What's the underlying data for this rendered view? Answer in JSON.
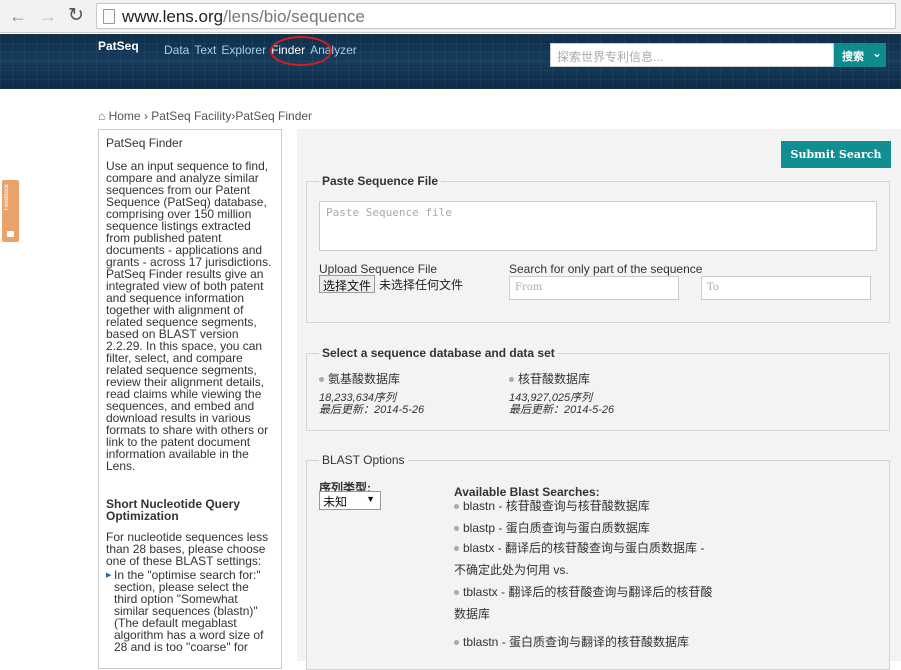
{
  "browser": {
    "url_host": "www.lens.org",
    "url_path": "/lens/bio/sequence"
  },
  "header": {
    "brand": "PatSeq",
    "nav": [
      "Data",
      "Text",
      "Explorer",
      "Finder",
      "Analyzer"
    ],
    "active_nav": "Finder",
    "search_placeholder": "探索世界专利信息...",
    "search_button": "搜索"
  },
  "feedback_label": "Feedback",
  "breadcrumb": {
    "home": "Home",
    "sep": "›",
    "facility": "PatSeq Facility",
    "current": "PatSeq Finder"
  },
  "sidebar": {
    "title": "PatSeq Finder",
    "intro": "Use an input sequence to find, compare and analyze similar sequences from our Patent Sequence (PatSeq) database, comprising over 150 million sequence listings extracted from published patent documents - applications and grants - across 17 jurisdictions. PatSeq Finder results give an integrated view of both patent and sequence information together with alignment of related sequence segments, based on BLAST version 2.2.29. In this space, you can filter, select, and compare related sequence segments, review their alignment details, read claims while viewing the sequences, and embed and download results in various formats to share with others or link to the patent document information available in the Lens.",
    "short_title": "Short Nucleotide Query Optimization",
    "short_note": "For nucleotide sequences less than 28 bases, please choose one of these BLAST settings:",
    "bullet": "In the \"optimise search for:\" section, please select the third option \"Somewhat similar sequences (blastn)\" (The default megablast algorithm has a word size of 28 and is too \"coarse\" for"
  },
  "main": {
    "submit_button": "Submit Search",
    "paste_panel": {
      "title": "Paste Sequence File",
      "textarea_placeholder": "Paste Sequence file",
      "upload_label": "Upload Sequence File",
      "file_button": "选择文件",
      "file_status": "未选择任何文件",
      "part_label": "Search for only part of the sequence",
      "from_placeholder": "From",
      "to_placeholder": "To"
    },
    "db_panel": {
      "title": "Select a sequence database and data set",
      "options": [
        {
          "name": "氨基酸数据库",
          "count": "18,233,634序列",
          "updated": "最后更新：2014-5-26"
        },
        {
          "name": "核苷酸数据库",
          "count": "143,927,025序列",
          "updated": "最后更新：2014-5-26"
        }
      ]
    },
    "blast_panel": {
      "title": "BLAST Options",
      "seqtype_label": "序列类型:",
      "seqtype_value": "未知",
      "available_label": "Available Blast Searches:",
      "searches": [
        {
          "name": "blastn",
          "desc": " - 核苷酸查询与核苷酸数据库"
        },
        {
          "name": "blastp",
          "desc": " - 蛋白质查询与蛋白质数据库"
        },
        {
          "name": "blastx",
          "desc": " - 翻译后的核苷酸查询与蛋白质数据库 - 不确定此处为何用 vs."
        },
        {
          "name": "tblastx",
          "desc": " - 翻译后的核苷酸查询与翻译后的核苷酸数据库"
        },
        {
          "name": "tblastn",
          "desc": " - 蛋白质查询与翻译的核苷酸数据库"
        }
      ]
    }
  }
}
